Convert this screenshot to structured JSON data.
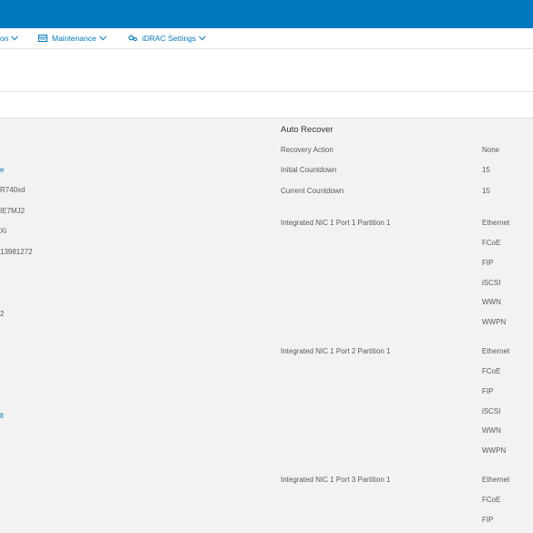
{
  "nav": {
    "partial_label": "on",
    "maintenance_label": "Maintenance",
    "idrac_label": "iDRAC Settings"
  },
  "left_column": {
    "v1": "e",
    "v2": "R740xd",
    "v3": "IE7MJ2",
    "v4": "Xi",
    "v5": "13981272",
    "v6": "2",
    "v7": "lt"
  },
  "auto_recover": {
    "title": "Auto Recover",
    "rows": [
      {
        "label": "Recovery Action",
        "value": "None"
      },
      {
        "label": "Initial Countdown",
        "value": "15"
      },
      {
        "label": "Current Countdown",
        "value": "15"
      }
    ]
  },
  "nics": [
    {
      "name": "Integrated NIC 1 Port 1 Partition 1",
      "protocols": [
        "Ethernet",
        "FCoE",
        "FIP",
        "iSCSI",
        "WWN",
        "WWPN"
      ]
    },
    {
      "name": "Integrated NIC 1 Port 2 Partition 1",
      "protocols": [
        "Ethernet",
        "FCoE",
        "FIP",
        "iSCSI",
        "WWN",
        "WWPN"
      ]
    },
    {
      "name": "Integrated NIC 1 Port 3 Partition 1",
      "protocols": [
        "Ethernet",
        "FCoE",
        "FIP"
      ]
    }
  ],
  "colors": {
    "brand_blue": "#0079bf",
    "panel_bg": "#f2f2f2"
  },
  "icons": [
    "maintenance-icon",
    "idrac-settings-icon",
    "chevron-down-icon"
  ]
}
